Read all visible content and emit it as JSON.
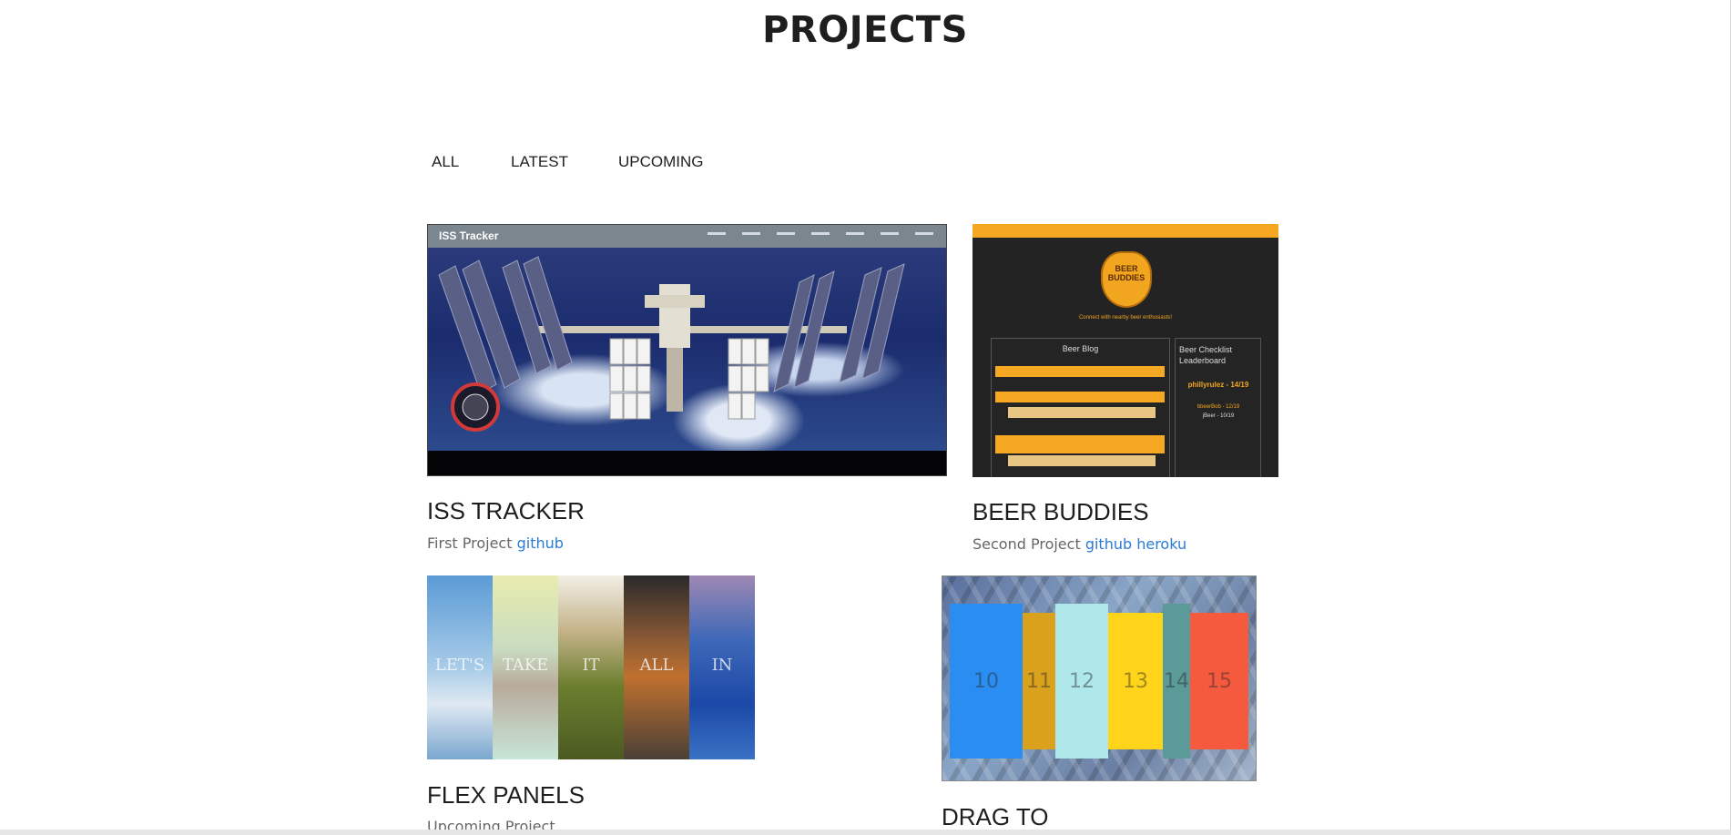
{
  "page": {
    "title": "PROJECTS"
  },
  "filters": [
    "ALL",
    "LATEST",
    "UPCOMING"
  ],
  "projects": [
    {
      "title": "ISS TRACKER",
      "desc": "First Project",
      "links": [
        "github"
      ],
      "thumb": {
        "brand": "ISS Tracker"
      }
    },
    {
      "title": "BEER BUDDIES",
      "desc": "Second Project",
      "links": [
        "github",
        "heroku"
      ],
      "thumb": {
        "logo": "BEER BUDDIES",
        "tagline": "Connect with nearby beer enthusiasts!",
        "blog_title": "Beer Blog",
        "leaderboard_title": "Beer Checklist Leaderboard",
        "leader": "phillyrulez - 14/19",
        "second": "bbeerBob - 12/19",
        "third": "jBeer - 10/19"
      }
    },
    {
      "title": "FLEX PANELS",
      "desc": "Upcoming Project",
      "panels": [
        "LET'S",
        "TAKE",
        "IT",
        "ALL",
        "IN"
      ]
    },
    {
      "title": "DRAG TO",
      "panels": [
        "10",
        "11",
        "12",
        "13",
        "14",
        "15"
      ]
    }
  ],
  "colors": {
    "link": "#2a7ad4",
    "beer_accent": "#f6a823",
    "heading": "#1e1e1e"
  }
}
